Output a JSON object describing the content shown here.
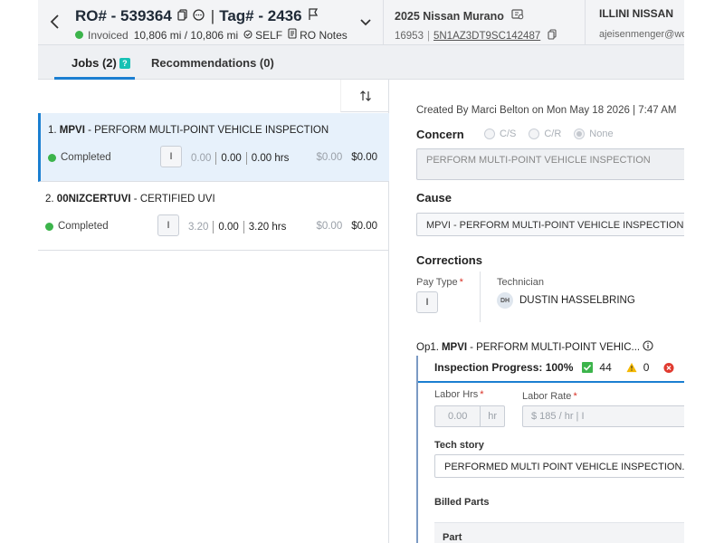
{
  "header": {
    "ro_label": "RO# - 539364",
    "tag_label": "Tag# - 2436",
    "status": "Invoiced",
    "mileage": "10,806 mi / 10,806 mi",
    "customer_type": "SELF",
    "ro_notes": "RO Notes",
    "vehicle": "2025 Nissan Murano",
    "stock": "16953",
    "vin": "5N1AZ3DT9SC142487",
    "dealer": "ILLINI NISSAN",
    "user_email": "ajeisenmenger@wd"
  },
  "tabs": [
    {
      "label": "Jobs (2)",
      "badge": "?"
    },
    {
      "label": "Recommendations (0)"
    }
  ],
  "jobs": [
    {
      "number": "1.",
      "code": "MPVI",
      "description": " - PERFORM MULTI-POINT VEHICLE INSPECTION",
      "status": "Completed",
      "pay_type": "I",
      "hrs_sold": "0.00",
      "hrs_actual": "0.00",
      "hrs_total": "0.00 hrs",
      "price_a": "$0.00",
      "price_b": "$0.00"
    },
    {
      "number": "2.",
      "code": "00NIZCERTUVI",
      "description": " - CERTIFIED UVI",
      "status": "Completed",
      "pay_type": "I",
      "hrs_sold": "3.20",
      "hrs_actual": "0.00",
      "hrs_total": "3.20 hrs",
      "price_a": "$0.00",
      "price_b": "$0.00"
    }
  ],
  "detail": {
    "created": "Created By Marci Belton on Mon May 18 2026 | 7:47 AM",
    "concern_label": "Concern",
    "concern_options": [
      "C/S",
      "C/R",
      "None"
    ],
    "concern_text": "PERFORM MULTI-POINT VEHICLE INSPECTION",
    "cause_label": "Cause",
    "cause_text": "MPVI - PERFORM MULTI-POINT VEHICLE INSPECTION",
    "corrections_label": "Corrections",
    "pay_type_label": "Pay Type",
    "pay_type_value": "I",
    "technician_label": "Technician",
    "technician_initials": "DH",
    "technician_name": "DUSTIN HASSELBRING",
    "op_prefix": "Op1.",
    "op_code": "MPVI",
    "op_desc": "- PERFORM MULTI-POINT VEHIC...",
    "inspection_label": "Inspection Progress: 100%",
    "count_green": "44",
    "count_yellow": "0",
    "labor_hrs_label": "Labor Hrs",
    "labor_hrs_value": "0.00",
    "labor_hrs_unit": "hr",
    "labor_rate_label": "Labor Rate",
    "labor_rate_value": "$ 185 / hr | I",
    "tech_story_label": "Tech story",
    "tech_story_value": "PERFORMED MULTI POINT VEHICLE INSPECTION. SU",
    "billed_parts_label": "Billed Parts",
    "part_col": "Part"
  },
  "colors": {
    "accent": "#1b7fd1",
    "completed": "#3cb44b",
    "warning": "#f5b800",
    "error": "#e03a2f"
  }
}
